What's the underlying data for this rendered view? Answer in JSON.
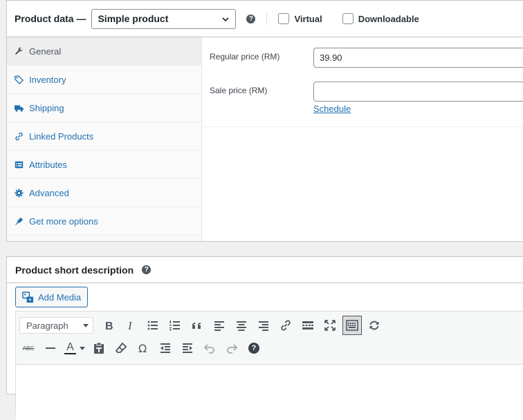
{
  "product_data": {
    "title": "Product data —",
    "product_type": "Simple product",
    "help_glyph": "?",
    "virtual_label": "Virtual",
    "downloadable_label": "Downloadable",
    "tabs": [
      {
        "label": "General",
        "icon": "wrench-icon"
      },
      {
        "label": "Inventory",
        "icon": "tag-icon"
      },
      {
        "label": "Shipping",
        "icon": "truck-icon"
      },
      {
        "label": "Linked Products",
        "icon": "link-icon"
      },
      {
        "label": "Attributes",
        "icon": "list-icon"
      },
      {
        "label": "Advanced",
        "icon": "gear-icon"
      },
      {
        "label": "Get more options",
        "icon": "plugin-icon"
      }
    ],
    "regular_price_label": "Regular price (RM)",
    "regular_price_value": "39.90",
    "sale_price_label": "Sale price (RM)",
    "sale_price_value": "",
    "schedule_link": "Schedule"
  },
  "short_description": {
    "title": "Product short description",
    "help_glyph": "?",
    "add_media_label": "Add Media",
    "format_select": "Paragraph",
    "abc_label": "ABC",
    "text_color_glyph": "A"
  },
  "colors": {
    "link": "#2271b1",
    "border": "#c3c4c7",
    "text": "#1d2327",
    "icon": "#50575e"
  }
}
